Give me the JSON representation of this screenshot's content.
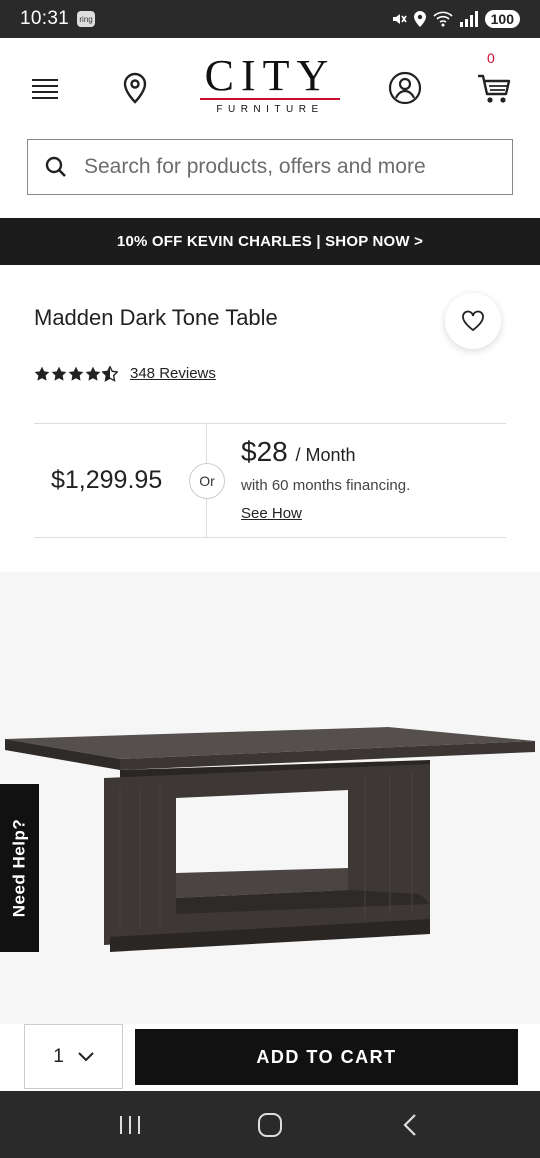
{
  "status_bar": {
    "time": "10:31",
    "app_badge": "ring",
    "battery": "100"
  },
  "header": {
    "logo_main": "CITY",
    "logo_sub": "FURNITURE",
    "cart_count": "0"
  },
  "search": {
    "placeholder": "Search for products, offers and more"
  },
  "promo": {
    "text": "10% OFF KEVIN CHARLES | SHOP NOW >"
  },
  "product": {
    "title": "Madden Dark Tone Table",
    "rating": 4.5,
    "reviews": "348 Reviews",
    "price": "$1,299.95",
    "or_label": "Or",
    "monthly_amount": "$28",
    "monthly_unit": "/ Month",
    "financing_text": "with 60 months financing.",
    "see_how": "See How"
  },
  "need_help": "Need Help?",
  "cart_bar": {
    "quantity": "1",
    "add_to_cart": "ADD TO CART"
  },
  "colors": {
    "brand_red": "#c8102e",
    "dark": "#111111",
    "wood": "#3d3836"
  }
}
